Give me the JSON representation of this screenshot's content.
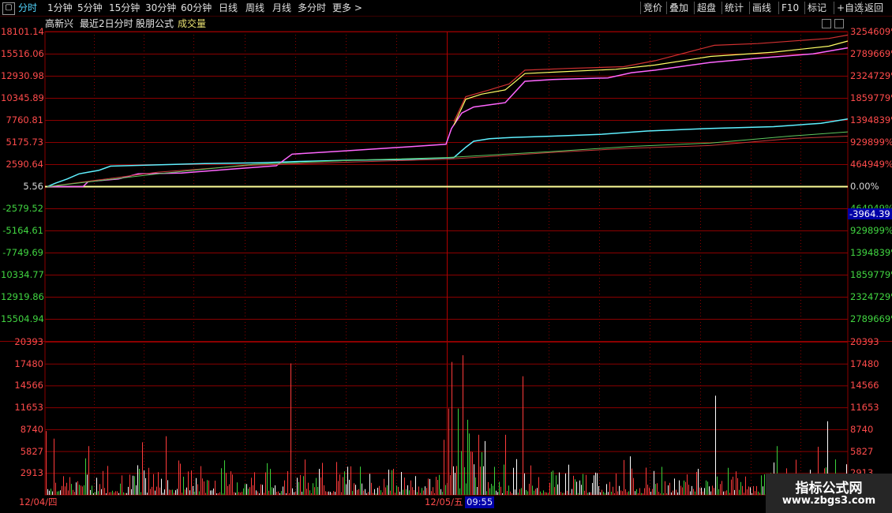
{
  "toolbar": {
    "left": [
      "分时",
      "1分钟",
      "5分钟",
      "15分钟",
      "30分钟",
      "60分钟",
      "日线",
      "周线",
      "月线",
      "多分时",
      "更多 >"
    ],
    "right": [
      "竞价",
      "叠加",
      "超盘",
      "统计",
      "画线",
      "F10",
      "标记",
      "+自选",
      "返回"
    ],
    "active_index": 0
  },
  "info": {
    "stock_name": "高新兴",
    "period_label": "最近2日分时",
    "formula_label": "股朋公式",
    "indicator_label": "成交量"
  },
  "price_axis": {
    "left_labels": [
      "18101.14",
      "15516.06",
      "12930.98",
      "10345.89",
      "7760.81",
      "5175.73",
      "2590.64",
      "5.56",
      "-2579.52",
      "-5164.61",
      "-7749.69",
      "10334.77",
      "12919.86",
      "15504.94"
    ],
    "right_labels": [
      "3254609%",
      "2789669%",
      "2324729%",
      "1859779%",
      "1394839%",
      "929899%",
      "464949%",
      "0.00%",
      "464949%",
      "929899%",
      "1394839%",
      "1859779%",
      "2324729%",
      "2789669%"
    ],
    "baseline_index": 7,
    "min": -15504.94,
    "max": 18101.14
  },
  "volume_axis": {
    "labels": [
      "20393",
      "17480",
      "14566",
      "11653",
      "8740",
      "5827",
      "2913"
    ],
    "max": 20393
  },
  "cursor_value": "-3964.39",
  "dates": {
    "day1": "12/04/四",
    "day2": "12/05/五",
    "time": "09:55"
  },
  "watermark": {
    "title": "指标公式网",
    "url": "www.zbgs3.com"
  },
  "colors": {
    "grid": "#8b0000",
    "up": "#ff4b4b",
    "down": "#41d541",
    "cyan": "#5ff0ff",
    "magenta": "#ff66ff",
    "yellow": "#ffff66",
    "white": "#ffffff"
  }
}
